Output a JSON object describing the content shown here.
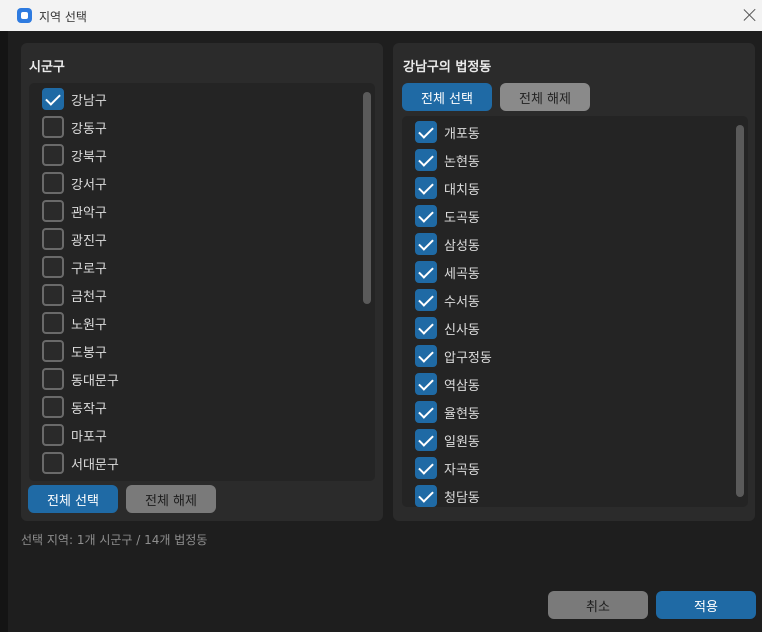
{
  "window": {
    "title": "지역 선택"
  },
  "left_panel": {
    "title": "시군구",
    "items": [
      {
        "label": "강남구",
        "checked": true
      },
      {
        "label": "강동구",
        "checked": false
      },
      {
        "label": "강북구",
        "checked": false
      },
      {
        "label": "강서구",
        "checked": false
      },
      {
        "label": "관악구",
        "checked": false
      },
      {
        "label": "광진구",
        "checked": false
      },
      {
        "label": "구로구",
        "checked": false
      },
      {
        "label": "금천구",
        "checked": false
      },
      {
        "label": "노원구",
        "checked": false
      },
      {
        "label": "도봉구",
        "checked": false
      },
      {
        "label": "동대문구",
        "checked": false
      },
      {
        "label": "동작구",
        "checked": false
      },
      {
        "label": "마포구",
        "checked": false
      },
      {
        "label": "서대문구",
        "checked": false
      }
    ],
    "select_all": "전체 선택",
    "deselect_all": "전체 해제"
  },
  "right_panel": {
    "title": "강남구의 법정동",
    "select_all": "전체 선택",
    "deselect_all": "전체 해제",
    "items": [
      {
        "label": "개포동",
        "checked": true
      },
      {
        "label": "논현동",
        "checked": true
      },
      {
        "label": "대치동",
        "checked": true
      },
      {
        "label": "도곡동",
        "checked": true
      },
      {
        "label": "삼성동",
        "checked": true
      },
      {
        "label": "세곡동",
        "checked": true
      },
      {
        "label": "수서동",
        "checked": true
      },
      {
        "label": "신사동",
        "checked": true
      },
      {
        "label": "압구정동",
        "checked": true
      },
      {
        "label": "역삼동",
        "checked": true
      },
      {
        "label": "율현동",
        "checked": true
      },
      {
        "label": "일원동",
        "checked": true
      },
      {
        "label": "자곡동",
        "checked": true
      },
      {
        "label": "청담동",
        "checked": true
      }
    ]
  },
  "status": "선택 지역: 1개 시군구 / 14개 법정동",
  "footer": {
    "cancel": "취소",
    "apply": "적용"
  }
}
